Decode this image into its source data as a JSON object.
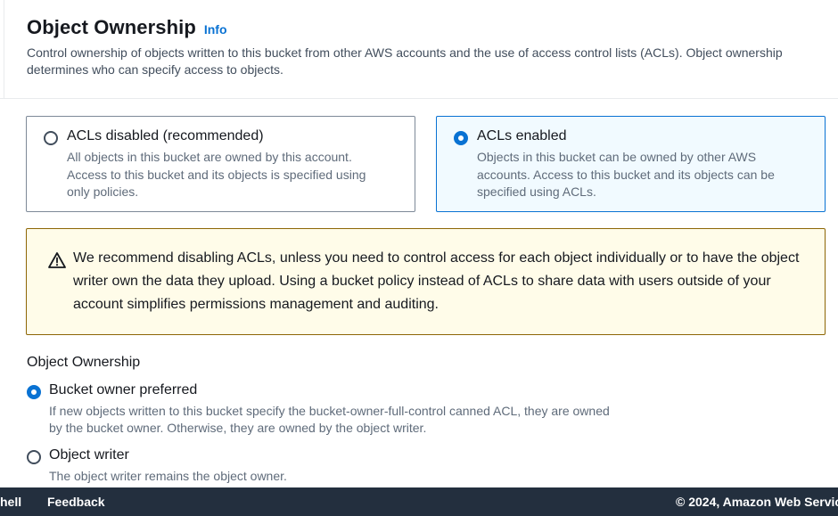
{
  "header": {
    "title": "Object Ownership",
    "info_link": "Info",
    "description": "Control ownership of objects written to this bucket from other AWS accounts and the use of access control lists (ACLs). Object ownership determines who can specify access to objects."
  },
  "acl_tiles": [
    {
      "title": "ACLs disabled (recommended)",
      "description": "All objects in this bucket are owned by this account. Access to this bucket and its objects is specified using only policies.",
      "selected": false
    },
    {
      "title": "ACLs enabled",
      "description": "Objects in this bucket can be owned by other AWS accounts. Access to this bucket and its objects can be specified using ACLs.",
      "selected": true
    }
  ],
  "warning": {
    "icon": "warning-triangle-icon",
    "text": "We recommend disabling ACLs, unless you need to control access for each object individually or to have the object writer own the data they upload. Using a bucket policy instead of ACLs to share data with users outside of your account simplifies permissions management and auditing."
  },
  "ownership": {
    "label": "Object Ownership",
    "options": [
      {
        "label": "Bucket owner preferred",
        "description": "If new objects written to this bucket specify the bucket-owner-full-control canned ACL, they are owned by the bucket owner. Otherwise, they are owned by the object writer.",
        "selected": true
      },
      {
        "label": "Object writer",
        "description": "The object writer remains the object owner.",
        "selected": false
      }
    ]
  },
  "footer": {
    "shell": "hell",
    "feedback": "Feedback",
    "copyright": "© 2024, Amazon Web Servic"
  },
  "colors": {
    "accent": "#0972d3",
    "warning_bg": "#fffce9",
    "warning_border": "#8d6605",
    "footer_bg": "#232f3e"
  }
}
